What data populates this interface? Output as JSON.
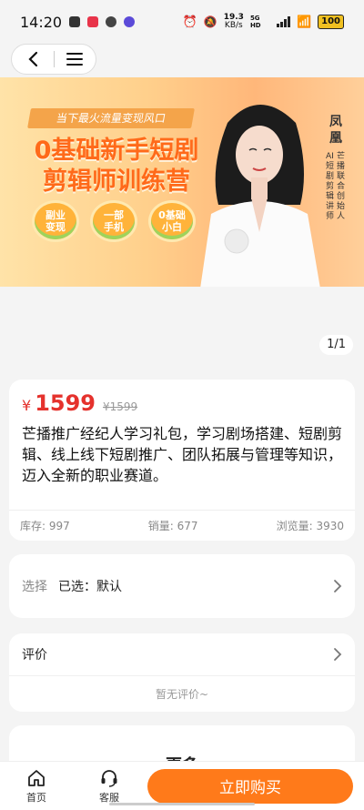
{
  "status_bar": {
    "time": "14:20",
    "net_speed_top": "19.3",
    "net_speed_bottom": "KB/s",
    "network": "5G HD",
    "battery": "100"
  },
  "nav": {
    "back_icon": "chevron-left-icon",
    "menu_icon": "menu-icon"
  },
  "banner": {
    "tag": "当下最火流量变现风口",
    "title_line1": "0基础新手短剧",
    "title_line2": "剪辑师训练营",
    "pills": [
      "副业\n变现",
      "一部\n手机",
      "0基础\n小白"
    ],
    "name": "凤凰",
    "role_col1": "芒播联合创始人",
    "role_col2": "AI短剧剪辑讲师"
  },
  "pager": "1/1",
  "product": {
    "currency": "¥",
    "price": "1599",
    "original_price": "¥1599",
    "description": "芒播推广经纪人学习礼包，学习剧场搭建、短剧剪辑、线上线下短剧推广、团队拓展与管理等知识，迈入全新的职业赛道。",
    "stock": "库存: 997",
    "sales": "销量: 677",
    "views": "浏览量: 3930"
  },
  "selection": {
    "label": "选择",
    "value": "已选：默认"
  },
  "reviews": {
    "title": "评价",
    "empty": "暂无评价~"
  },
  "more": {
    "title": "更多"
  },
  "bottom": {
    "home_label": "首页",
    "service_label": "客服",
    "buy_label": "立即购买"
  },
  "colors": {
    "accent": "#ff7a1a",
    "price": "#e5322d"
  }
}
